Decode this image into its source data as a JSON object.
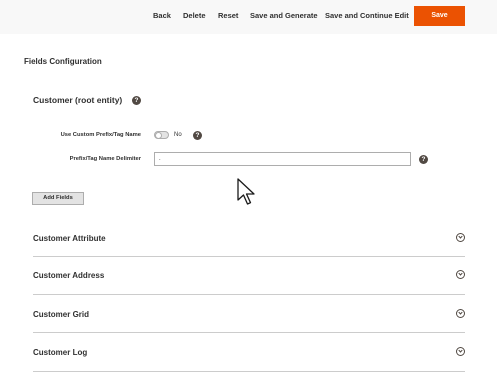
{
  "toolbar": {
    "back_label": "Back",
    "delete_label": "Delete",
    "reset_label": "Reset",
    "save_generate_label": "Save and Generate",
    "save_continue_label": "Save and Continue Edit",
    "save_label": "Save",
    "save_color": "#eb5202"
  },
  "fields_config": {
    "title": "Fields Configuration",
    "entity_title": "Customer (root entity)",
    "custom_prefix": {
      "label": "Use Custom Prefix/Tag Name",
      "toggle_value": "No"
    },
    "delimiter": {
      "label": "Prefix/Tag Name Delimiter",
      "value": "."
    },
    "add_fields_label": "Add Fields"
  },
  "sections": [
    {
      "title": "Customer Attribute"
    },
    {
      "title": "Customer Address"
    },
    {
      "title": "Customer Grid"
    },
    {
      "title": "Customer Log"
    }
  ],
  "icons": {
    "help": "help-icon",
    "chevron": "chevron-down-icon",
    "cursor": "mouse-pointer-icon"
  }
}
